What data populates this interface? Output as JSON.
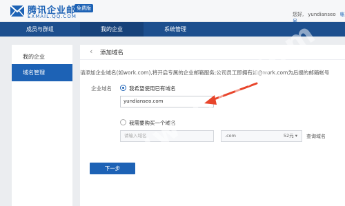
{
  "brand": {
    "title": "腾讯企业邮",
    "badge": "免费版",
    "domain": "EXMAIL.QQ.COM",
    "color": "#1d62b5"
  },
  "user_bar": {
    "greeting": "您好,",
    "username": "yundianseo",
    "account_label": "帐号"
  },
  "nav": {
    "items": [
      "成员与群组",
      "我的企业",
      "系统管理"
    ],
    "active": "我的企业"
  },
  "sidebar": {
    "items": [
      "我的企业",
      "域名管理"
    ],
    "active": "域名管理"
  },
  "main": {
    "back_icon": "‹",
    "title": "添加域名",
    "instruction": "请添加企业域名(如work.com),将开启专属的企业邮箱服务;公司员工即拥有如@work.com为后缀的邮箱帐号",
    "field_label": "企业域名",
    "option_existing": "我希望使用已有域名",
    "domain_value": "yundianseo.com",
    "option_buy": "我需要购买一个域名",
    "buy_placeholder": "请输入域名",
    "tld_value": ".com",
    "price_value": "52元",
    "query_label": "查询域名",
    "next_button": "下一步"
  },
  "watermark": "www.z..com"
}
